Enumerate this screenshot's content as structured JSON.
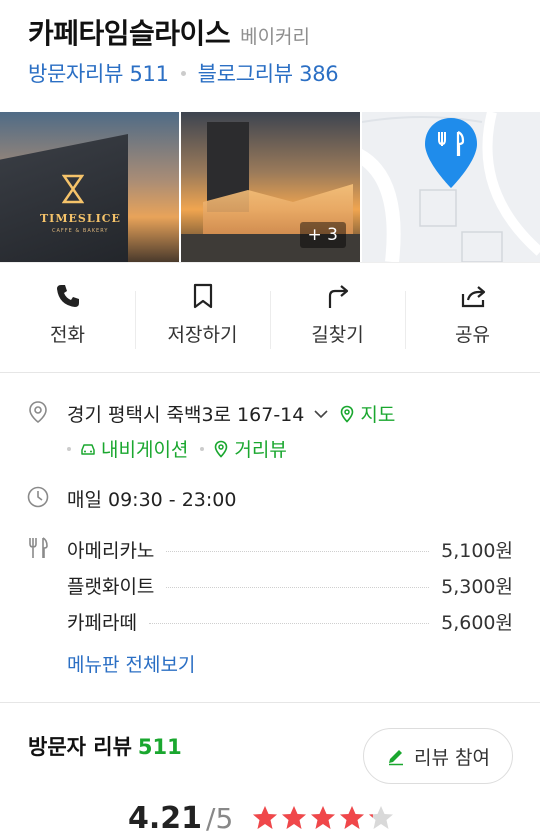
{
  "place": {
    "name": "카페타임슬라이스",
    "category": "베이커리",
    "visitor_reviews_label": "방문자리뷰 511",
    "blog_reviews_label": "블로그리뷰 386"
  },
  "photos": {
    "logo_text": "TIMESLICE",
    "logo_sub": "CAFFE & BAKERY",
    "more_count": "+ 3"
  },
  "actions": [
    {
      "label": "전화",
      "icon": "phone-icon"
    },
    {
      "label": "저장하기",
      "icon": "bookmark-icon"
    },
    {
      "label": "길찾기",
      "icon": "directions-icon"
    },
    {
      "label": "공유",
      "icon": "share-icon"
    }
  ],
  "info": {
    "address": "경기 평택시 죽백3로 167-14",
    "map_link": "지도",
    "navigation_link": "내비게이션",
    "streetview_link": "거리뷰",
    "hours": "매일 09:30 - 23:00",
    "menu": [
      {
        "name": "아메리카노",
        "price": "5,100원"
      },
      {
        "name": "플랫화이트",
        "price": "5,300원"
      },
      {
        "name": "카페라떼",
        "price": "5,600원"
      }
    ],
    "menu_more": "메뉴판 전체보기"
  },
  "reviews": {
    "title": "방문자 리뷰",
    "count": "511",
    "write_button": "리뷰 참여",
    "rating": "4.21",
    "rating_max": "/5",
    "stars_filled": 4.21
  },
  "colors": {
    "link_blue": "#2b6fc4",
    "green": "#1aa72f",
    "pin_blue": "#1f8ceb",
    "star_red": "#f0474a"
  }
}
